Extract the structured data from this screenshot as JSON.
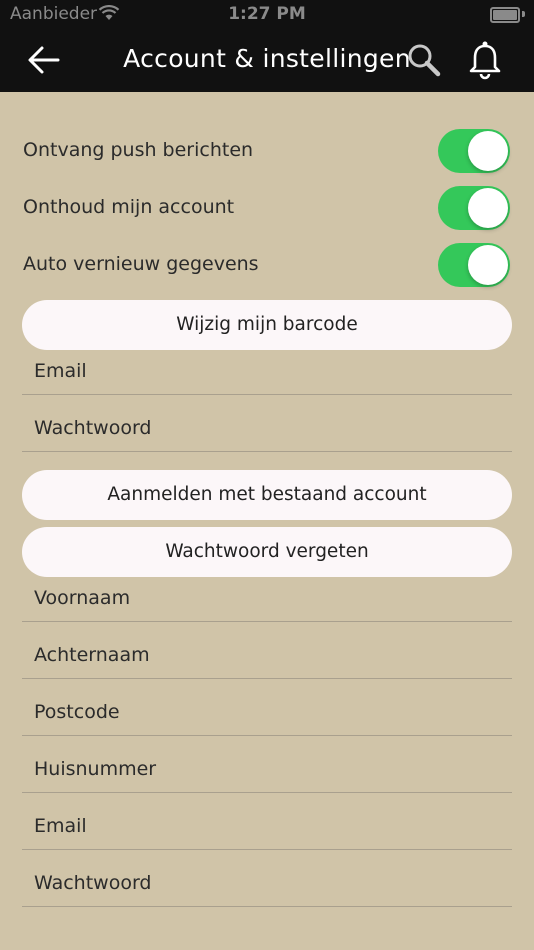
{
  "status_bar": {
    "carrier": "Aanbieder",
    "time": "1:27 PM",
    "icons": [
      "wifi-icon",
      "battery-icon"
    ]
  },
  "nav": {
    "title": "Account & instellingen",
    "icons": [
      "back-arrow-icon",
      "search-icon",
      "bell-icon"
    ]
  },
  "toggles": [
    {
      "label": "Ontvang push berichten",
      "on": true
    },
    {
      "label": "Onthoud mijn account",
      "on": true
    },
    {
      "label": "Auto vernieuw gegevens",
      "on": true
    }
  ],
  "buttons": {
    "change_barcode": "Wijzig mijn barcode",
    "login_existing": "Aanmelden met bestaand account",
    "forgot_password": "Wachtwoord vergeten"
  },
  "login_fields": {
    "email": "Email",
    "password": "Wachtwoord"
  },
  "register_fields": {
    "first_name": "Voornaam",
    "last_name": "Achternaam",
    "postcode": "Postcode",
    "house_number": "Huisnummer",
    "email": "Email",
    "password": "Wachtwoord"
  },
  "colors": {
    "background": "#d0c4a8",
    "navbar": "#111111",
    "toggle_on": "#34c85a",
    "button_bg": "#fcf7f9"
  }
}
